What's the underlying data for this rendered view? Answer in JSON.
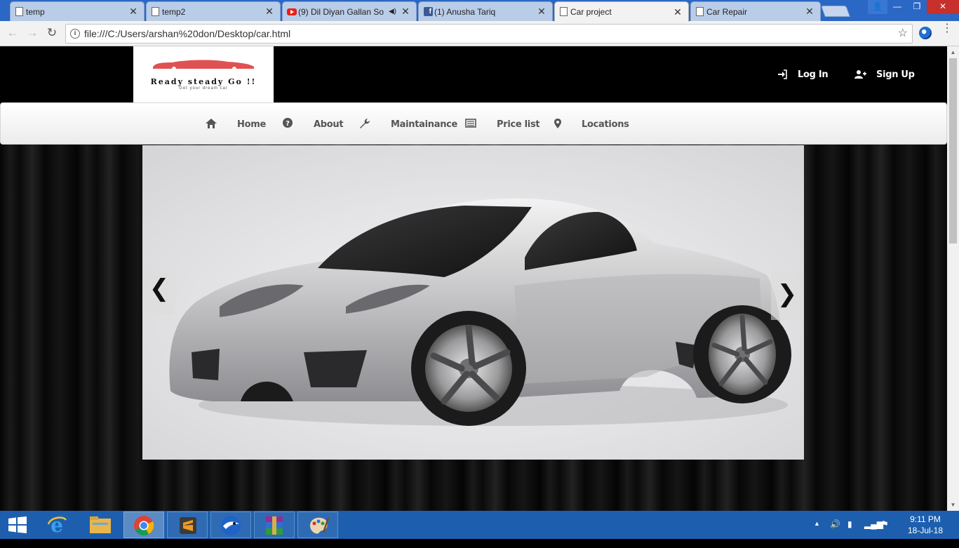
{
  "browser": {
    "tabs": [
      {
        "title": "temp",
        "icon": "page-icon",
        "active": false
      },
      {
        "title": "temp2",
        "icon": "page-icon",
        "active": false
      },
      {
        "title": "(9) Dil Diyan Gallan So",
        "icon": "youtube-icon",
        "active": false,
        "audio": true
      },
      {
        "title": "(1) Anusha Tariq",
        "icon": "facebook-icon",
        "active": false
      },
      {
        "title": "Car project",
        "icon": "page-icon",
        "active": true
      },
      {
        "title": "Car Repair",
        "icon": "page-icon",
        "active": false
      }
    ],
    "close_glyph": "✕",
    "url": "file:///C:/Users/arshan%20don/Desktop/car.html"
  },
  "site": {
    "logo": {
      "title": "Ready steady Go !!",
      "tagline": "Get your dream car",
      "brand_color": "#e05252"
    },
    "auth": {
      "login_label": "Log In",
      "signup_label": "Sign Up"
    },
    "nav": [
      {
        "label": "Home",
        "icon": "home-icon"
      },
      {
        "label": "About",
        "icon": "question-circle-icon"
      },
      {
        "label": "Maintainance",
        "icon": "wrench-icon"
      },
      {
        "label": "Price list",
        "icon": "list-alt-icon"
      },
      {
        "label": "Locations",
        "icon": "map-marker-icon"
      }
    ],
    "carousel": {
      "prev_glyph": "❮",
      "next_glyph": "❯",
      "slide": "silver sports car"
    }
  },
  "taskbar": {
    "apps": [
      "windows-start",
      "internet-explorer",
      "file-explorer",
      "chrome",
      "sublime-text",
      "browser-app",
      "winrar",
      "paint"
    ],
    "clock_time": "9:11 PM",
    "clock_date": "18-Jul-18"
  }
}
